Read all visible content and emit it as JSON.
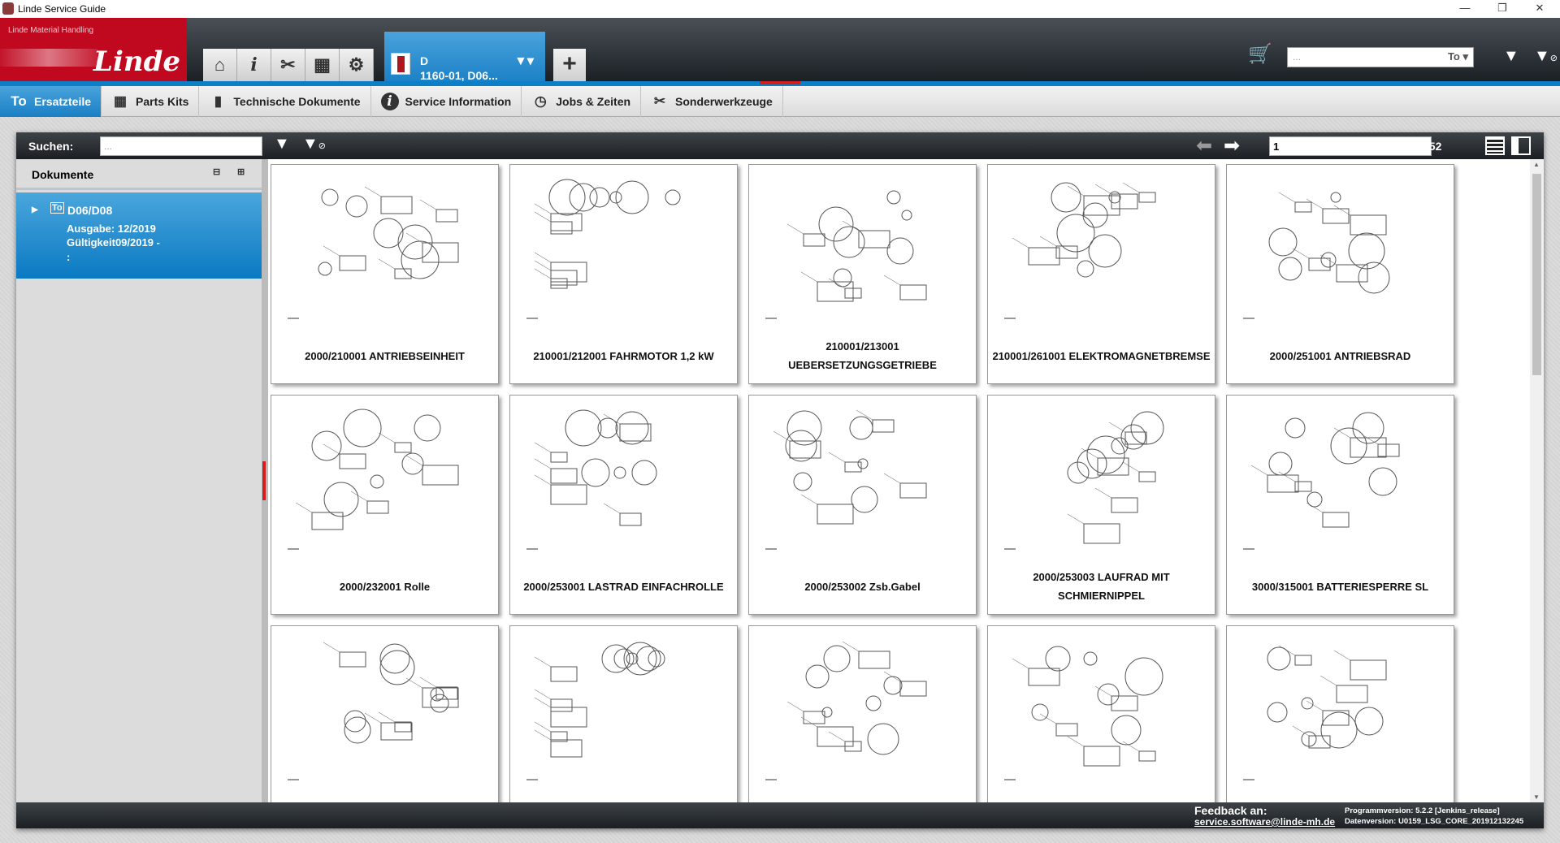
{
  "window": {
    "title": "Linde Service Guide",
    "minimize": "—",
    "restore": "❐",
    "close": "✕"
  },
  "logo": {
    "subtitle": "Linde Material Handling",
    "wordmark": "Linde"
  },
  "model_tab": {
    "line1": "D",
    "line2": "1160-01, D06..."
  },
  "header": {
    "search_placeholder": "...",
    "search_mode": "To"
  },
  "nav": [
    {
      "label": "Ersatzteile",
      "icon": "To"
    },
    {
      "label": "Parts Kits",
      "icon": "▦"
    },
    {
      "label": "Technische Dokumente",
      "icon": "▮"
    },
    {
      "label": "Service Information",
      "icon": "i"
    },
    {
      "label": "Jobs & Zeiten",
      "icon": "◷"
    },
    {
      "label": "Sonderwerkzeuge",
      "icon": "✂"
    }
  ],
  "toolbar": {
    "search_label": "Suchen:",
    "search_placeholder": "...",
    "page": "1",
    "total": "/ 52"
  },
  "sidebar": {
    "title": "Dokumente",
    "item": {
      "name": "D06/D08",
      "ausgabe": "Ausgabe: 12/2019",
      "gueltigkeit": "Gültigkeit09/2019 -",
      "extra": ":"
    }
  },
  "cards": [
    "2000/210001 ANTRIEBSEINHEIT",
    "210001/212001 FAHRMOTOR 1,2 kW",
    "210001/213001 UEBERSETZUNGSGETRIEBE",
    "210001/261001 ELEKTROMAGNETBREMSE",
    "2000/251001 ANTRIEBSRAD",
    "2000/232001 Rolle",
    "2000/253001 LASTRAD EINFACHROLLE",
    "2000/253002 Zsb.Gabel",
    "2000/253003 LAUFRAD MIT SCHMIERNIPPEL",
    "3000/315001 BATTERIESPERRE SL",
    "",
    "",
    "",
    "",
    ""
  ],
  "footer": {
    "feedback_label": "Feedback an:",
    "email": "service.software@linde-mh.de",
    "program_version": "Programmversion: 5.2.2 [Jenkins_release]",
    "data_version": "Datenversion: U0159_LSG_CORE_201912132245"
  }
}
